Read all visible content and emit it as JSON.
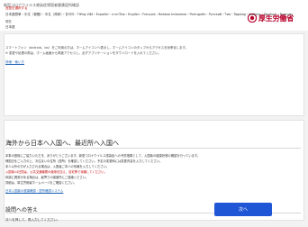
{
  "header": {
    "site_title": "新型コロナウイルス感染症帰国者健康居所確認",
    "logo_text": "厚生労働省",
    "logo_color": "#b8002a"
  },
  "language_card": {
    "select_label": "言語を選択する",
    "languages": "日本語簡単・中文（繁體）・中文（简体）・한국어・Tiếng Việt・Español・ภาษาไทย・English・Français・Bahasa Indonesia・Português・Русский・ไทย・Tagalog・Italiano・Deutsch・Français・ENGLISH・ಕನ್ನಡ",
    "current_label": "現在",
    "current_value": "日本語",
    "note_line1": "スマートフォン（android、ios）をご利用の方は、ホームアイコンへ表示し、ホームアイコンのタップからアクセスを効率化します。",
    "note_line2": "※ 変更や処理の際は、ホーム画面から再度アクセスし、必ずアプリケーションをダウンロードを入れてください。",
    "link": "詳細・使い方"
  },
  "main": {
    "title": "海外から日本へ入国へ、最近所へ入国へ",
    "lines": [
      "本事の登録にご協力いただき、ありがとうございます。新型コロナウイルス感染症への予防措置として、入国後の健康状態の確認を行っています。",
      "帰国日をご入力の上、お住まいの住所（居所）を確認してください。予定の変更時には変更内容を入力してください。",
      "本人以外の方が入力される場合は、入国者ご本人の情報を入力してください。",
      "入国後14日間は、公共交通機関の使用を控え、自宅等で待機してください。",
      "体調に異常がある場合は、最寄りの保健所にご連絡ください。",
      "詳細は、厚生労働省ホームページをご確認ください。"
    ],
    "link": "日本入国者の健康確認・居所確認システム"
  },
  "question": {
    "title": "設問への答え",
    "text": "次へを押して、再入力してください。",
    "next_label": "次へ",
    "button_color": "#1f56d6"
  }
}
